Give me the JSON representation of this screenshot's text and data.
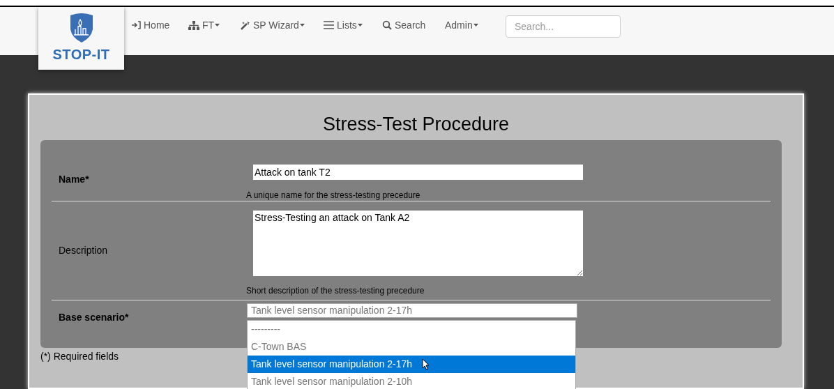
{
  "logo": {
    "text": "STOP-IT"
  },
  "nav": [
    {
      "label": "Home",
      "dropdown": false
    },
    {
      "label": "FT",
      "dropdown": true
    },
    {
      "label": "SP Wizard",
      "dropdown": true
    },
    {
      "label": "Lists",
      "dropdown": true
    },
    {
      "label": "Search",
      "dropdown": false
    },
    {
      "label": "Admin",
      "dropdown": true
    }
  ],
  "search": {
    "placeholder": "Search..."
  },
  "title": "Stress-Test Procedure",
  "form": {
    "name": {
      "label": "Name*",
      "value": "Attack on tank T2",
      "help": "A unique name for the stress-testing precedure"
    },
    "description": {
      "label": "Description",
      "value": "Stress-Testing an attack on Tank A2",
      "help": "Short description of the stress-testing precedure"
    },
    "base_scenario": {
      "label": "Base scenario*",
      "value": "Tank level sensor manipulation 2-17h",
      "expanded": true,
      "options": [
        {
          "label": "---------",
          "selected": false
        },
        {
          "label": "C-Town BAS",
          "selected": false
        },
        {
          "label": "Tank level sensor manipulation 2-17h",
          "selected": true
        },
        {
          "label": "Tank level sensor manipulation 2-10h",
          "selected": false
        }
      ]
    }
  },
  "required_note": "(*) Required fields"
}
